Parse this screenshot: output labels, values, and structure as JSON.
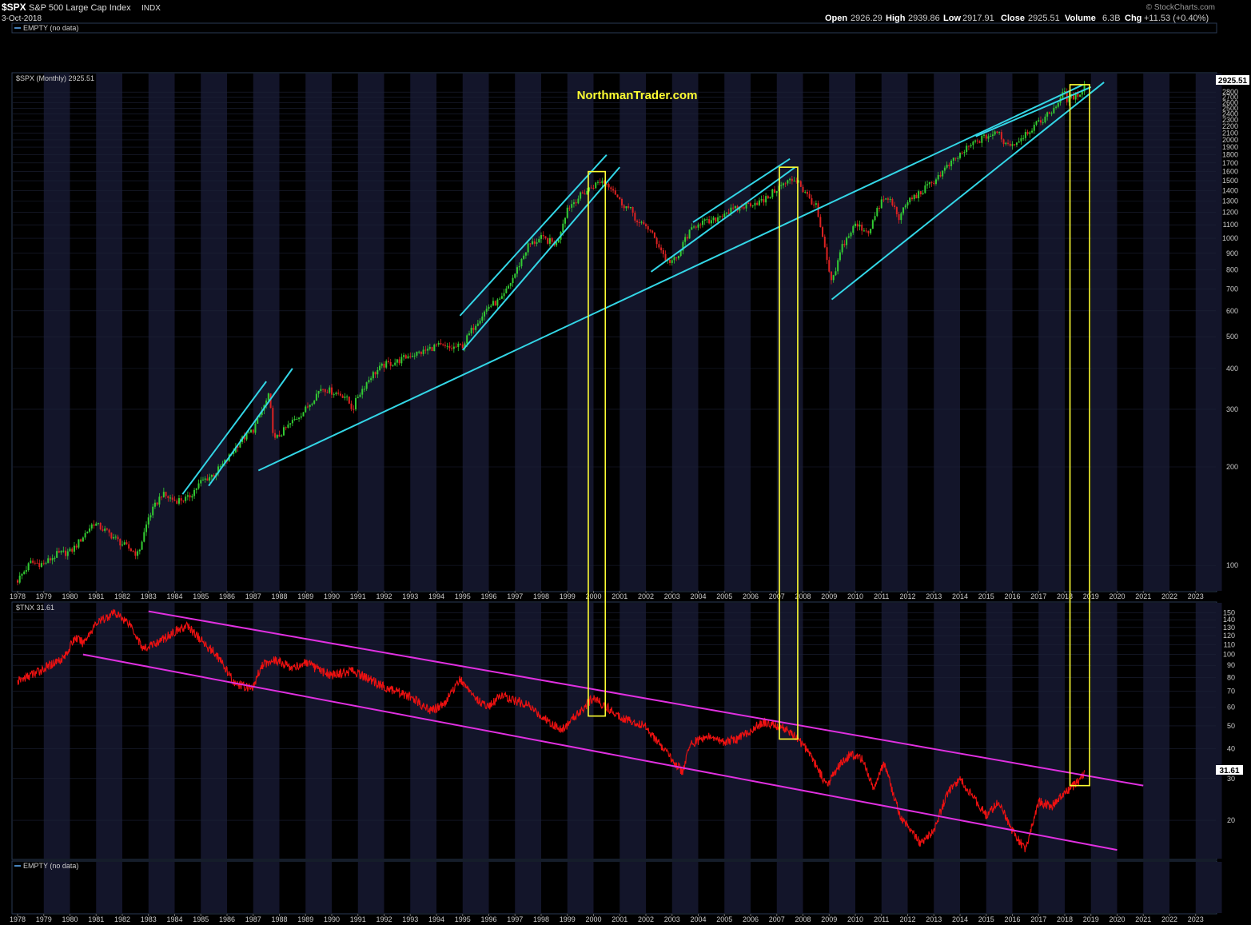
{
  "header": {
    "symbol": "$SPX",
    "name": "S&P 500 Large Cap Index",
    "exchange": "INDX",
    "date": "3-Oct-2018",
    "open_label": "Open",
    "open": "2926.29",
    "high_label": "High",
    "high": "2939.86",
    "low_label": "Low",
    "low": "2917.91",
    "close_label": "Close",
    "close": "2925.51",
    "volume_label": "Volume",
    "volume": "6.3B",
    "chg_label": "Chg",
    "chg": "+11.53 (+0.40%)",
    "brand": "© StockCharts.com"
  },
  "panels": {
    "empty_top": "EMPTY (no data)",
    "empty_bottom": "EMPTY (no data)",
    "spx_label": "$SPX (Monthly) 2925.51",
    "spx_last": "2925.51",
    "tnx_label": "$TNX 31.61",
    "tnx_last": "31.61",
    "watermark": "NorthmanTrader.com"
  },
  "colors": {
    "background": "#000000",
    "band": "#13152a",
    "up": "#33cc33",
    "down": "#dd2222",
    "trendline_spx": "#33d6e6",
    "trendline_tnx": "#e030e0",
    "highlight": "#ffff33",
    "watermark": "#ffff33",
    "tnx_line": "#ee1111"
  },
  "chart_data": [
    {
      "type": "candlestick",
      "title": "$SPX (Monthly)",
      "scale": "log",
      "x_ticks": [
        "1978",
        "1979",
        "1980",
        "1981",
        "1982",
        "1983",
        "1984",
        "1985",
        "1986",
        "1987",
        "1988",
        "1989",
        "1990",
        "1991",
        "1992",
        "1993",
        "1994",
        "1995",
        "1996",
        "1997",
        "1998",
        "1999",
        "2000",
        "2001",
        "2002",
        "2003",
        "2004",
        "2005",
        "2006",
        "2007",
        "2008",
        "2009",
        "2010",
        "2011",
        "2012",
        "2013",
        "2014",
        "2015",
        "2016",
        "2017",
        "2018",
        "2019",
        "2020",
        "2021",
        "2022",
        "2023"
      ],
      "y_ticks": [
        100,
        200,
        300,
        400,
        500,
        600,
        700,
        800,
        900,
        1000,
        1100,
        1200,
        1300,
        1400,
        1500,
        1600,
        1700,
        1800,
        1900,
        2000,
        2100,
        2200,
        2300,
        2400,
        2500,
        2600,
        2700,
        2800
      ],
      "ylim": [
        85,
        3050
      ],
      "series": [
        {
          "x": [
            1978.0,
            1978.5,
            1979.0,
            1979.5,
            1980.0,
            1980.2,
            1980.9,
            1981.5,
            1982.0,
            1982.6,
            1983.0,
            1983.5,
            1984.0,
            1984.5,
            1985.0,
            1985.5,
            1986.0,
            1986.5,
            1987.0,
            1987.6,
            1987.8,
            1988.0,
            1988.5,
            1989.0,
            1989.6,
            1990.0,
            1990.5,
            1990.8,
            1991.0,
            1991.5,
            1992.0,
            1992.5,
            1993.0,
            1993.5,
            1994.0,
            1994.5,
            1995.0,
            1995.5,
            1996.0,
            1996.5,
            1997.0,
            1997.5,
            1998.0,
            1998.6,
            1998.8,
            1999.0,
            1999.5,
            2000.0,
            2000.3,
            2000.7,
            2001.0,
            2001.5,
            2001.7,
            2002.0,
            2002.5,
            2002.8,
            2003.2,
            2003.5,
            2004.0,
            2004.5,
            2005.0,
            2005.5,
            2006.0,
            2006.5,
            2007.0,
            2007.5,
            2007.8,
            2008.0,
            2008.5,
            2008.8,
            2009.1,
            2009.5,
            2010.0,
            2010.5,
            2011.0,
            2011.3,
            2011.7,
            2012.0,
            2012.5,
            2013.0,
            2013.5,
            2014.0,
            2014.5,
            2015.0,
            2015.5,
            2015.7,
            2016.1,
            2016.5,
            2017.0,
            2017.5,
            2018.0,
            2018.1,
            2018.5,
            2018.75
          ],
          "close": [
            90,
            102,
            101,
            108,
            110,
            114,
            135,
            125,
            116,
            108,
            140,
            165,
            158,
            160,
            180,
            190,
            210,
            240,
            260,
            330,
            240,
            250,
            275,
            300,
            350,
            340,
            330,
            300,
            330,
            380,
            410,
            420,
            440,
            450,
            470,
            460,
            470,
            550,
            620,
            650,
            780,
            950,
            1000,
            960,
            1100,
            1240,
            1350,
            1450,
            1500,
            1440,
            1300,
            1200,
            1100,
            1100,
            950,
            850,
            860,
            1000,
            1120,
            1120,
            1200,
            1230,
            1280,
            1300,
            1420,
            1500,
            1520,
            1400,
            1250,
            950,
            720,
            950,
            1100,
            1050,
            1300,
            1320,
            1150,
            1300,
            1380,
            1500,
            1650,
            1800,
            1950,
            2050,
            2100,
            1950,
            1950,
            2100,
            2250,
            2450,
            2800,
            2650,
            2750,
            2925
          ]
        }
      ],
      "trendlines": 9,
      "highlights": [
        "2000",
        "2007",
        "2018"
      ]
    },
    {
      "type": "line",
      "title": "$TNX",
      "scale": "log",
      "x_ticks": [
        "1978",
        "1979",
        "1980",
        "1981",
        "1982",
        "1983",
        "1984",
        "1985",
        "1986",
        "1987",
        "1988",
        "1989",
        "1990",
        "1991",
        "1992",
        "1993",
        "1994",
        "1995",
        "1996",
        "1997",
        "1998",
        "1999",
        "2000",
        "2001",
        "2002",
        "2003",
        "2004",
        "2005",
        "2006",
        "2007",
        "2008",
        "2009",
        "2010",
        "2011",
        "2012",
        "2013",
        "2014",
        "2015",
        "2016",
        "2017",
        "2018",
        "2019",
        "2020",
        "2021",
        "2022",
        "2023"
      ],
      "y_ticks": [
        20,
        30,
        40,
        50,
        60,
        70,
        80,
        90,
        100,
        110,
        120,
        130,
        140,
        150
      ],
      "ylim": [
        14,
        160
      ],
      "series": [
        {
          "x": [
            1978.0,
            1979.0,
            1979.8,
            1980.2,
            1980.5,
            1981.0,
            1981.7,
            1982.3,
            1982.8,
            1983.5,
            1984.0,
            1984.5,
            1985.0,
            1985.6,
            1986.3,
            1987.0,
            1987.3,
            1987.8,
            1988.5,
            1989.0,
            1989.6,
            1990.0,
            1990.8,
            1991.5,
            1992.0,
            1992.5,
            1993.0,
            1993.8,
            1994.3,
            1994.9,
            1995.5,
            1996.0,
            1996.5,
            1997.0,
            1997.5,
            1998.0,
            1998.8,
            1999.5,
            2000.0,
            2000.5,
            2001.0,
            2001.5,
            2002.0,
            2002.5,
            2003.4,
            2003.7,
            2004.3,
            2005.0,
            2005.5,
            2006.0,
            2006.5,
            2007.0,
            2007.4,
            2007.8,
            2008.3,
            2008.9,
            2009.3,
            2009.8,
            2010.3,
            2010.7,
            2011.1,
            2011.7,
            2012.0,
            2012.5,
            2013.0,
            2013.5,
            2014.0,
            2014.5,
            2015.0,
            2015.5,
            2016.0,
            2016.5,
            2017.0,
            2017.5,
            2018.0,
            2018.5,
            2018.75
          ],
          "values": [
            77,
            87,
            98,
            118,
            112,
            135,
            150,
            135,
            105,
            115,
            125,
            132,
            115,
            100,
            75,
            72,
            90,
            95,
            88,
            92,
            85,
            82,
            85,
            78,
            73,
            70,
            66,
            58,
            62,
            79,
            65,
            60,
            68,
            64,
            61,
            55,
            48,
            58,
            66,
            60,
            55,
            52,
            50,
            42,
            32,
            42,
            45,
            43,
            44,
            48,
            52,
            50,
            48,
            44,
            38,
            28,
            33,
            38,
            36,
            27,
            35,
            21,
            19,
            16,
            18,
            26,
            30,
            25,
            21,
            24,
            18,
            15,
            24,
            23,
            26,
            29,
            31.61
          ]
        }
      ],
      "trendlines": 2
    }
  ]
}
